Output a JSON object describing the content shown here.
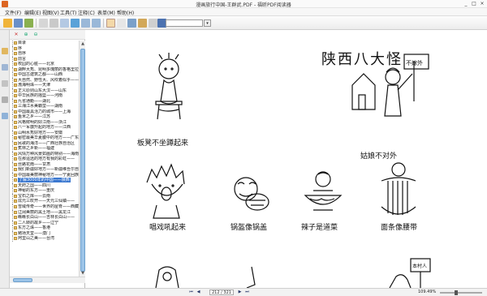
{
  "window": {
    "title": "漫画旅行中国-王群武.PDF - 福昕PDF阅读器",
    "controls": [
      "_",
      "□",
      "×"
    ]
  },
  "menubar": {
    "items": [
      "文件(F)",
      "编辑(E)",
      "视图(V)",
      "工具(T)",
      "注释(C)",
      "表单(M)",
      "帮助(H)"
    ]
  },
  "toolbar": {
    "search_value": ""
  },
  "sidebar": {
    "toc": [
      "目录",
      "序",
      "自序",
      "前言",
      "校园的心脏——北京",
      "湖畔大秀、昆明多瑰丽的香格里拉之旅",
      "中国古建筑之都——山西",
      "大自然、野性大、风吹着似乎——",
      "渤海明珠——天津",
      "正义原则山东大汉——山东",
      "中华民族的摇篮——河南",
      "九省通衢——湖北",
      "三湘江水美霸蛮——湖南",
      "中国最具活力的城市——上海",
      "鱼米之乡——江苏",
      "风格鲜明的好江南——浙江",
      "八一军旗升起的地方——江西",
      "山明水秀好地方——安徽",
      "秘密最美华夏腹中的地方——广东",
      "民歌的海洋——广西壮族自治区",
      "蕉林之乡新——福建",
      "风情万种风景如画的特别——海南",
      "在那遥远的地方有我的彩虹——",
      "丝路花雨——甘肃",
      "我们新疆好地方——新疆维吾尔自治区",
      "中国最美丽神秘地方——宁夏回族自治区",
      "了解3000年的中国——陕西",
      "天府之国——四川",
      "神秘的东方——重庆",
      "宝石之库——云南",
      "炫元三叹开——天元三仙镇——",
      "雪域传奇——世界的屋脊——西藏",
      "辽阔美丽的黑土地——黑龙江",
      "瞧瞧长白山——吉林长白山——",
      "二人转的故乡——辽宁",
      "东方之珠——香港",
      "赌场天堂——澳门",
      "阿里山之美——台湾"
    ],
    "selected_index": 26
  },
  "document": {
    "title": "陕西八大怪",
    "captions": [
      "板凳不坐蹲起来",
      "姑娘不对外",
      "唱戏吼起来",
      "锅盔像锅盖",
      "辣子是道菜",
      "面条像腰带"
    ],
    "sign_text": "不嫁外",
    "sign_text2": "本村人"
  },
  "statusbar": {
    "page": "212 / 321",
    "zoom": "109.49%"
  },
  "colors": {
    "accent": "#3b78d0",
    "bookmark": "#e9c36b"
  }
}
